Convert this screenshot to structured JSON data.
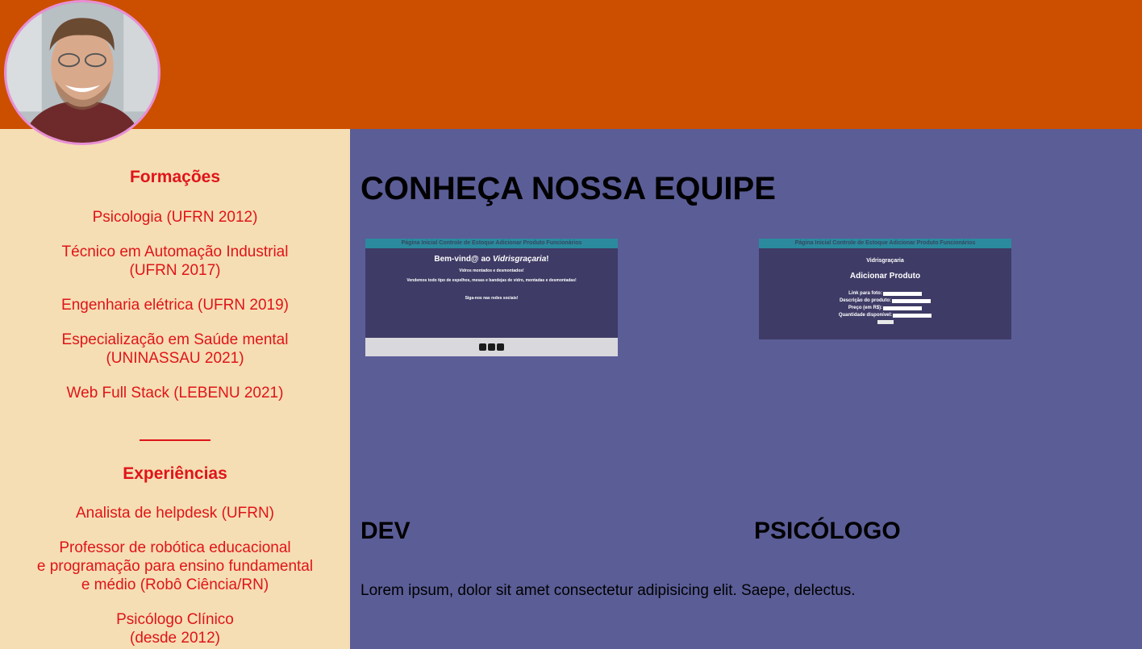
{
  "header": {
    "avatar_label": "profile-photo"
  },
  "sidebar": {
    "formacoes_title": "Formações",
    "formacoes": [
      "Psicologia (UFRN 2012)",
      "Técnico em Automação Industrial\n(UFRN 2017)",
      "Engenharia elétrica (UFRN 2019)",
      "Especialização em Saúde mental\n(UNINASSAU 2021)",
      "Web Full Stack (LEBENU 2021)"
    ],
    "experiencias_title": "Experiências",
    "experiencias": [
      "Analista de helpdesk (UFRN)",
      "Professor de robótica educacional\ne programação para ensino fundamental\ne médio (Robô Ciência/RN)",
      "Psicólogo Clínico\n(desde 2012)"
    ]
  },
  "main": {
    "title": "CONHEÇA NOSSA EQUIPE",
    "shot1": {
      "nav": "Página Inicial  Controle de Estoque  Adicionar Produto  Funcionários",
      "welcome_prefix": "Bem-vind@ ao ",
      "welcome_brand": "Vidrisgraçaria",
      "welcome_suffix": "!",
      "line1": "Vidros montados e desmontados!",
      "line2": "Vendemos todo tipo de espelhos, mesas e bandejas de vidro, montadas e desmontadas!",
      "line3": "Siga-nos nas redes sociais!"
    },
    "shot2": {
      "nav": "Página Inicial  Controle de Estoque  Adicionar Produto  Funcionários",
      "brand": "Vidrisgraçaria",
      "heading": "Adicionar Produto",
      "fields": [
        "Link para foto:",
        "Descrição do produto:",
        "Preço (em R$):",
        "Quantidade disponível:"
      ],
      "button": "enviar"
    },
    "role1": "DEV",
    "role2": "PSICÓLOGO",
    "lorem": "Lorem ipsum, dolor sit amet consectetur adipisicing elit. Saepe, delectus."
  }
}
